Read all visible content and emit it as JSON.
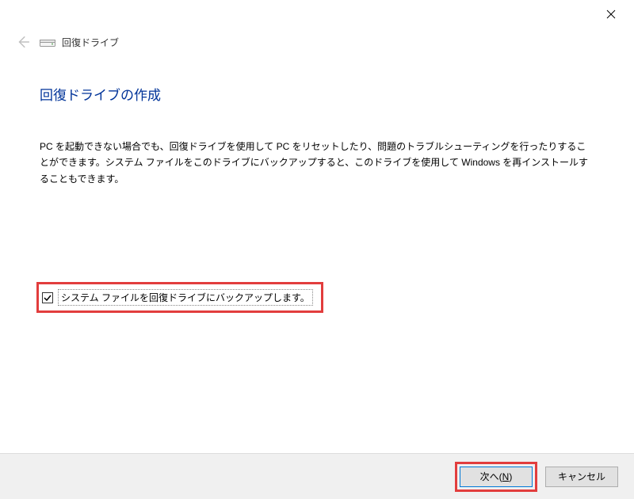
{
  "titlebar": {
    "close_icon": "close"
  },
  "header": {
    "title": "回復ドライブ"
  },
  "page": {
    "title": "回復ドライブの作成",
    "description": "PC を起動できない場合でも、回復ドライブを使用して PC をリセットしたり、問題のトラブルシューティングを行ったりすることができます。システム ファイルをこのドライブにバックアップすると、このドライブを使用して Windows を再インストールすることもできます。"
  },
  "checkbox": {
    "label": "システム ファイルを回復ドライブにバックアップします。",
    "checked": true
  },
  "footer": {
    "next_prefix": "次へ(",
    "next_key": "N",
    "next_suffix": ")",
    "cancel": "キャンセル"
  },
  "highlight_color": "#e23d3d"
}
